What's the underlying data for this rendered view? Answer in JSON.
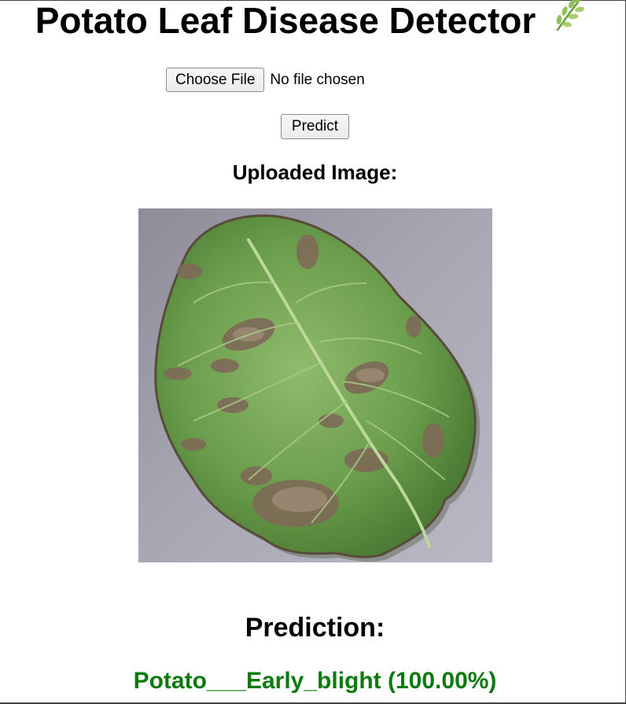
{
  "page": {
    "title": "Potato Leaf Disease Detector",
    "title_icon": "herb-icon"
  },
  "upload": {
    "choose_file_label": "Choose File",
    "file_status": "No file chosen",
    "predict_label": "Predict"
  },
  "uploaded": {
    "heading": "Uploaded Image:",
    "image": "potato-leaf-photo"
  },
  "prediction": {
    "heading": "Prediction:",
    "result": "Potato___Early_blight (100.00%)",
    "result_color": "#0d7a0d"
  },
  "colors": {
    "background": "#ffffff",
    "text": "#000000",
    "result": "#0d7a0d"
  }
}
